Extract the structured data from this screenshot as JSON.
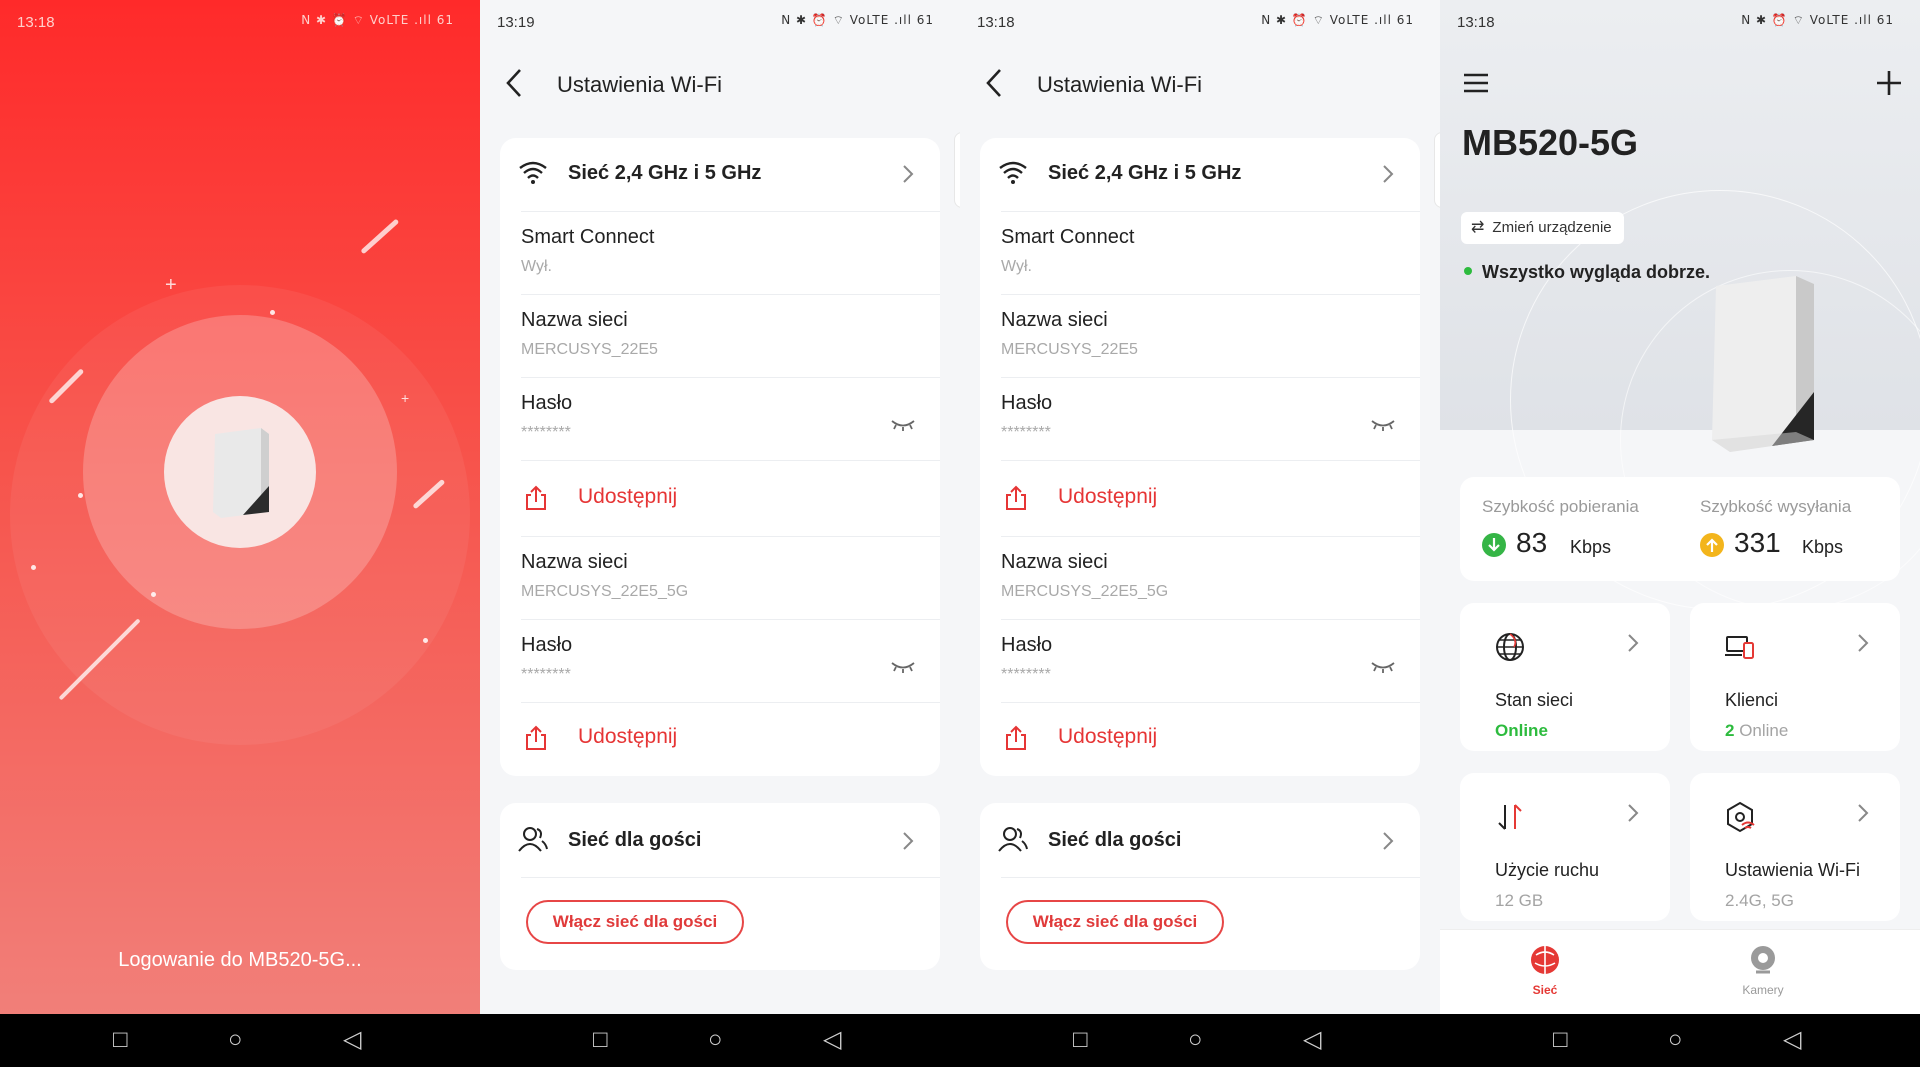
{
  "screens": [
    {
      "status": {
        "time": "13:18",
        "icons": "N ✱ ⏰ ⌔ VoLTE .ıll 61"
      },
      "login_text": "Logowanie do MB520-5G..."
    },
    {
      "status": {
        "time": "13:19",
        "icons": "N ✱ ⏰ ⌔ VoLTE .ıll 61"
      },
      "title": "Ustawienia Wi-Fi",
      "network_header": "Sieć 2,4 GHz i 5 GHz",
      "smart_connect": {
        "label": "Smart Connect",
        "value": "Wył."
      },
      "band24": {
        "name_label": "Nazwa sieci",
        "name_value": "MERCUSYS_22E5",
        "pass_label": "Hasło",
        "pass_value": "********",
        "share": "Udostępnij"
      },
      "band5": {
        "name_label": "Nazwa sieci",
        "name_value": "MERCUSYS_22E5_5G",
        "pass_label": "Hasło",
        "pass_value": "********",
        "share": "Udostępnij"
      },
      "guest": {
        "title": "Sieć dla gości",
        "button": "Włącz sieć dla gości"
      }
    },
    {
      "status": {
        "time": "13:18",
        "icons": "N ✱ ⏰ ⌔ VoLTE .ıll 61"
      },
      "title": "Ustawienia Wi-Fi",
      "network_header": "Sieć 2,4 GHz i 5 GHz",
      "smart_connect": {
        "label": "Smart Connect",
        "value": "Wył."
      },
      "band24": {
        "name_label": "Nazwa sieci",
        "name_value": "MERCUSYS_22E5",
        "pass_label": "Hasło",
        "pass_value": "********",
        "share": "Udostępnij"
      },
      "band5": {
        "name_label": "Nazwa sieci",
        "name_value": "MERCUSYS_22E5_5G",
        "pass_label": "Hasło",
        "pass_value": "********",
        "share": "Udostępnij"
      },
      "guest": {
        "title": "Sieć dla gości",
        "button": "Włącz sieć dla gości"
      }
    },
    {
      "status": {
        "time": "13:18",
        "icons": "N ✱ ⏰ ⌔ VoLTE .ıll 61"
      },
      "device_name": "MB520-5G",
      "change_device": "Zmień urządzenie",
      "status_text": "Wszystko wygląda dobrze.",
      "download": {
        "label": "Szybkość pobierania",
        "value": "83",
        "unit": "Kbps"
      },
      "upload": {
        "label": "Szybkość wysyłania",
        "value": "331",
        "unit": "Kbps"
      },
      "tiles": [
        {
          "label": "Stan sieci",
          "value": "Online",
          "icon": "globe-icon"
        },
        {
          "label": "Klienci",
          "value_count": "2",
          "value_rest": " Online",
          "icon": "devices-icon"
        },
        {
          "label": "Użycie ruchu",
          "value": "12 GB",
          "icon": "traffic-icon"
        },
        {
          "label": "Ustawienia Wi-Fi",
          "value": "2.4G, 5G",
          "icon": "wifi-settings-icon"
        }
      ],
      "nav": [
        {
          "label": "Sieć",
          "active": true
        },
        {
          "label": "Kamery",
          "active": false
        }
      ]
    }
  ],
  "colors": {
    "accent": "#e53935",
    "online": "#2dbb3e",
    "download": "#35b546",
    "upload": "#f3b51c"
  }
}
